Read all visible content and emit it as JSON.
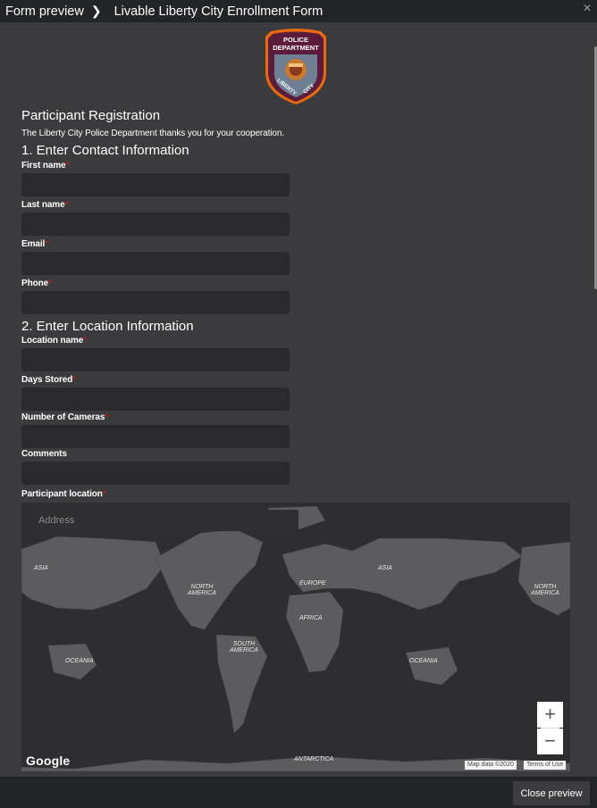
{
  "header": {
    "breadcrumb_root": "Form preview",
    "breadcrumb_sep": "❯",
    "breadcrumb_current": "Livable Liberty City Enrollment Form",
    "close_glyph": "✕"
  },
  "logo": {
    "top_text_1": "POLICE",
    "top_text_2": "DEPARTMENT",
    "bottom_left": "LIBERTY",
    "bottom_right": "CITY",
    "colors": {
      "border": "#e86a10",
      "top": "#5b1b3a",
      "shield": "#6e7f93"
    }
  },
  "form": {
    "title": "Participant Registration",
    "thanks": "The Liberty City Police Department thanks you for your cooperation.",
    "required_mark": "*",
    "section1": "1. Enter Contact Information",
    "section2": "2. Enter Location Information",
    "fields": {
      "first_name": {
        "label": "First name",
        "value": ""
      },
      "last_name": {
        "label": "Last name",
        "value": ""
      },
      "email": {
        "label": "Email",
        "value": ""
      },
      "phone": {
        "label": "Phone",
        "value": ""
      },
      "location_name": {
        "label": "Location name",
        "value": ""
      },
      "days_stored": {
        "label": "Days Stored",
        "value": ""
      },
      "num_cameras": {
        "label": "Number of Cameras",
        "value": ""
      },
      "comments": {
        "label": "Comments",
        "value": ""
      },
      "participant_location": {
        "label": "Participant location"
      }
    }
  },
  "map": {
    "address_placeholder": "Address",
    "zoom_in": "+",
    "zoom_out": "−",
    "google": "Google",
    "map_data": "Map data ©2020",
    "terms": "Terms of Use",
    "labels": {
      "asia_left": "ASIA",
      "na_left_1": "NORTH",
      "na_left_2": "AMERICA",
      "europe": "EUROPE",
      "asia_right": "ASIA",
      "na_right_1": "NORTH",
      "na_right_2": "AMERICA",
      "africa": "AFRICA",
      "sa_1": "SOUTH",
      "sa_2": "AMERICA",
      "oceania_left": "OCEANIA",
      "oceania_right": "OCEANIA",
      "antarctica": "ANTARCTICA"
    }
  },
  "footer": {
    "close_preview": "Close preview"
  }
}
